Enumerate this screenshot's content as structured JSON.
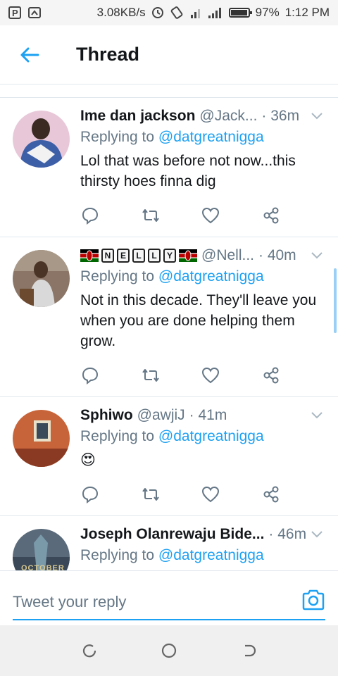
{
  "status_bar": {
    "speed": "3.08KB/s",
    "battery": "97%",
    "battery_level": 0.97,
    "time": "1:12 PM"
  },
  "header": {
    "title": "Thread",
    "back_icon": "back-arrow-icon"
  },
  "tweets": [
    {
      "name": "Ime dan jackson",
      "handle": "@Jack...",
      "time": "· 36m",
      "replying_label": "Replying to",
      "mention": "@datgreatnigga",
      "text": "Lol that was before not now...this thirsty hoes finna dig"
    },
    {
      "name_letters": [
        "N",
        "E",
        "L",
        "L",
        "Y"
      ],
      "handle": "@Nell...",
      "time": "· 40m",
      "replying_label": "Replying to",
      "mention": "@datgreatnigga",
      "text": "Not in this decade. They'll leave you when you are done helping them grow."
    },
    {
      "name": "Sphiwo",
      "handle": "@awjiJ",
      "time": "· 41m",
      "replying_label": "Replying to",
      "mention": "@datgreatnigga",
      "text": "😍"
    },
    {
      "name": "Joseph Olanrewaju Bide...",
      "handle": "",
      "time": "· 46m",
      "replying_label": "Replying to",
      "mention": "@datgreatnigga",
      "avatar_text": "OCTOBER"
    }
  ],
  "reply_bar": {
    "placeholder": "Tweet your reply"
  },
  "colors": {
    "accent": "#1da1f2",
    "secondary_text": "#657786"
  }
}
